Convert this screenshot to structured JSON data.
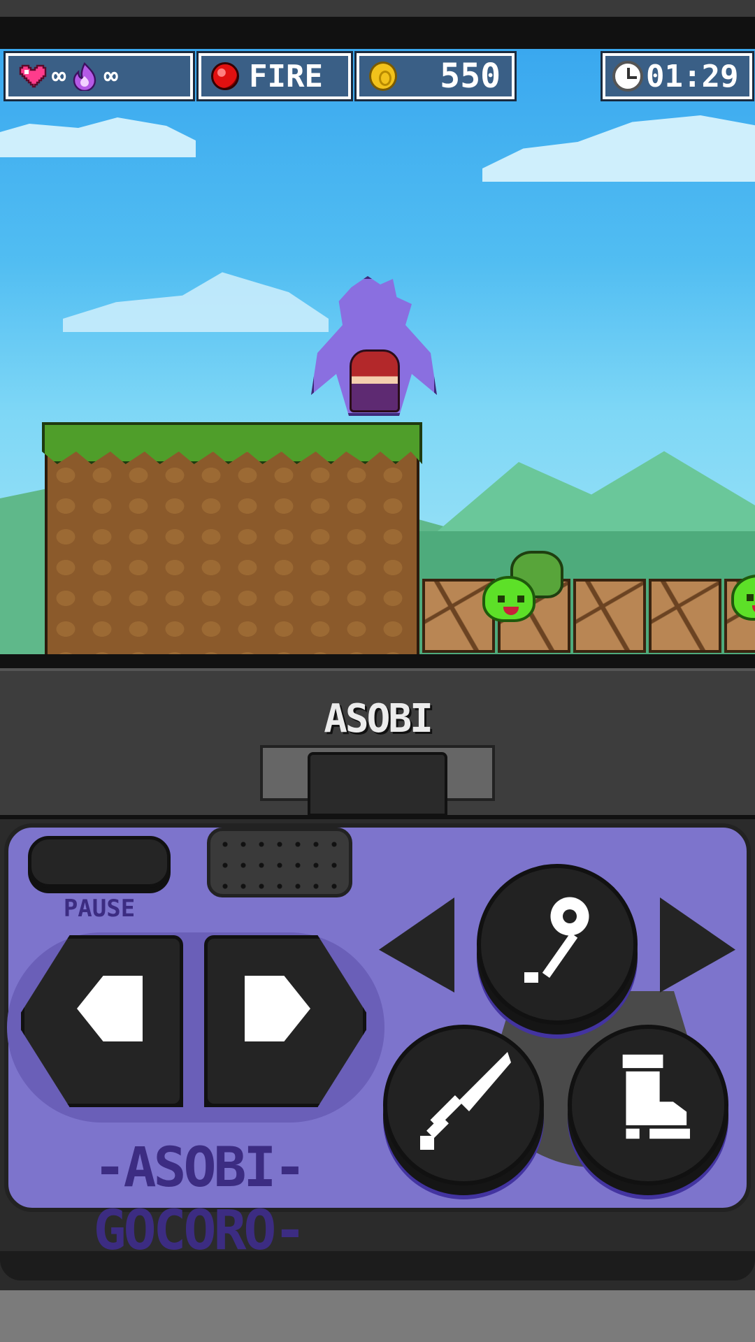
{
  "hud": {
    "lives": "∞",
    "magic": "∞",
    "power_name": "FIRE",
    "coins": "550",
    "timer": "01:29"
  },
  "console": {
    "brand_top": "ASOBI GOCORO",
    "brand_bottom": "-ASOBI-GOCORO-",
    "pause_label": "PAUSE"
  },
  "icons": {
    "lives": "heart-icon",
    "magic": "flame-icon",
    "power": "fire-orb-icon",
    "coins": "coin-icon",
    "timer": "clock-icon",
    "magic_button": "staff-icon",
    "attack_button": "sword-icon",
    "jump_button": "boot-icon"
  },
  "colors": {
    "sky": "#51bdf2",
    "hud_box": "#3a5f86",
    "panel": "#7d74cc",
    "brand_text": "#3c2c82"
  }
}
